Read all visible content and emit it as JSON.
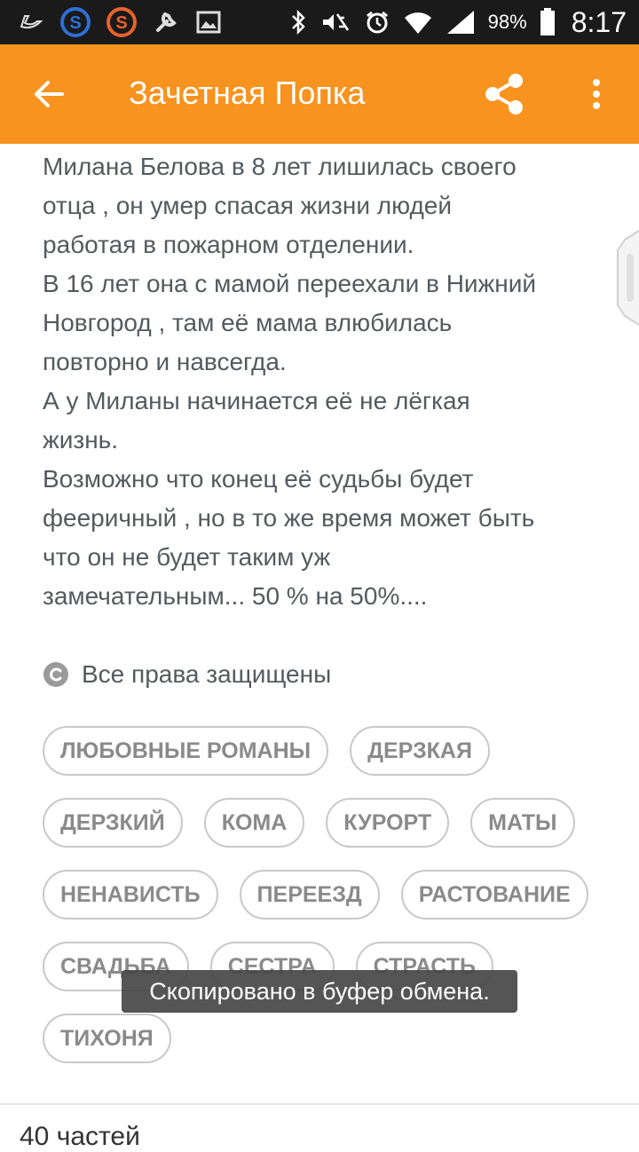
{
  "status_bar": {
    "battery": "98%",
    "time": "8:17",
    "left_icons": [
      "bird-icon",
      "s-app-blue-icon",
      "s-app-orange-icon",
      "wrench-icon",
      "image-icon"
    ],
    "right_icons": [
      "bluetooth-icon",
      "mute-icon",
      "alarm-icon",
      "wifi-icon",
      "signal-icon",
      "battery-icon"
    ]
  },
  "app_bar": {
    "title": "Зачетная Попка",
    "color": "#f7931e"
  },
  "description": {
    "lines": [
      "Милана Белова в 8 лет лишилась своего",
      "отца , он умер спасая жизни людей",
      "работая в пожарном отделении.",
      "В 16 лет она с мамой переехали в Нижний",
      "Новгород , там её мама влюбилась",
      "повторно и навсегда.",
      "А у Миланы начинается её не лёгкая",
      "жизнь.",
      "Возможно что конец её судьбы будет",
      "фееричный , но в то же время может быть",
      "что он не будет таким уж",
      "замечательным... 50 % на 50%...."
    ]
  },
  "copyright": {
    "text": "Все права защищены"
  },
  "tags": {
    "rows": [
      [
        "ЛЮБОВНЫЕ РОМАНЫ",
        "ДЕРЗКАЯ"
      ],
      [
        "ДЕРЗКИЙ",
        "КОМА",
        "КУРОРТ",
        "МАТЫ"
      ],
      [
        "НЕНАВИСТЬ",
        "ПЕРЕЕЗД",
        "РАСТОВАНИЕ"
      ],
      [
        "СВАДЬБА",
        "СЕСТРА",
        "СТРАСТЬ"
      ],
      [
        "ТИХОНЯ"
      ]
    ]
  },
  "toast": {
    "text": "Скопировано в буфер обмена."
  },
  "footer": {
    "parts_count": "40 частей"
  }
}
